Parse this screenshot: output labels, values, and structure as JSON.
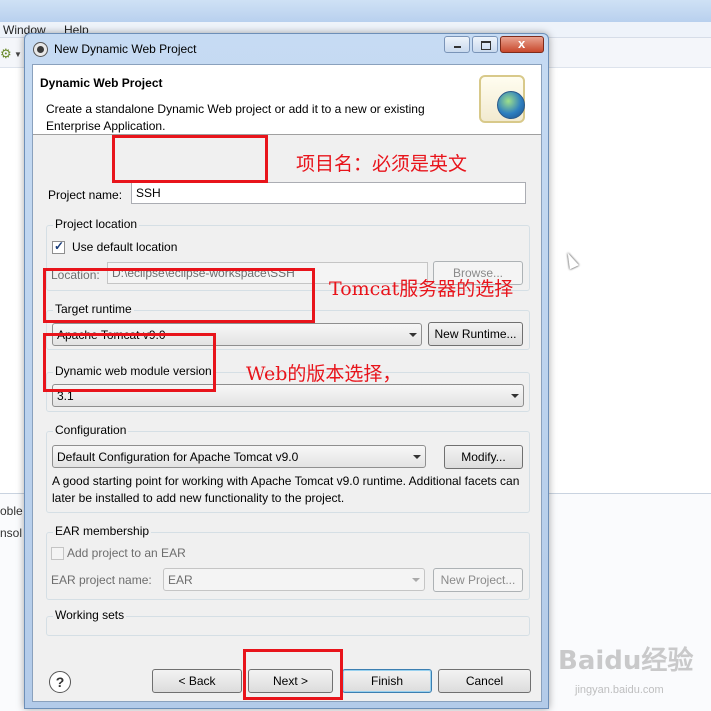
{
  "background": {
    "menu": [
      "Window",
      "Help"
    ],
    "bottom_tabs": [
      "oble",
      "nsol"
    ]
  },
  "dialog": {
    "title": "New Dynamic Web Project",
    "icon": "eclipse-icon",
    "banner": {
      "heading": "Dynamic Web Project",
      "description": "Create a standalone Dynamic Web project or add it to a new or existing Enterprise Application.",
      "image": "web-project-globe-icon"
    },
    "project_name": {
      "label": "Project name:",
      "value": "SSH"
    },
    "project_location": {
      "title": "Project location",
      "use_default_label": "Use default location",
      "use_default_checked": true,
      "location_label": "Location:",
      "location_value": "D:\\eclipse\\eclipse-workspace\\SSH",
      "browse_label": "Browse..."
    },
    "target_runtime": {
      "title": "Target runtime",
      "selected": "Apache Tomcat v9.0",
      "new_runtime_label": "New Runtime..."
    },
    "module_version": {
      "title": "Dynamic web module version",
      "selected": "3.1"
    },
    "configuration": {
      "title": "Configuration",
      "selected": "Default Configuration for Apache Tomcat v9.0",
      "modify_label": "Modify...",
      "description": "A good starting point for working with Apache Tomcat v9.0 runtime. Additional facets can later be installed to add new functionality to the project."
    },
    "ear": {
      "title": "EAR membership",
      "add_label": "Add project to an EAR",
      "add_checked": false,
      "project_label": "EAR project name:",
      "project_value": "EAR",
      "new_project_label": "New Project..."
    },
    "working_sets": {
      "title": "Working sets"
    },
    "buttons": {
      "back": "< Back",
      "next": "Next >",
      "finish": "Finish",
      "cancel": "Cancel"
    }
  },
  "annotations": {
    "project_name_note": "项目名：必须是英文",
    "runtime_note": "Tomcat服务器的选择",
    "version_note": "Web的版本选择，",
    "color": "#e8141b"
  },
  "watermark": {
    "logo": "Baidu经验",
    "url": "jingyan.baidu.com"
  }
}
